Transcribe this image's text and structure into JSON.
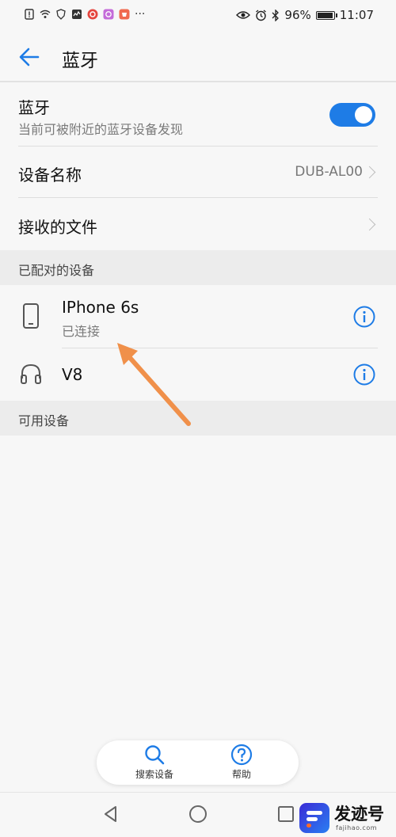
{
  "status_bar": {
    "battery_percent": "96%",
    "battery_level": 0.96,
    "time": "11:07",
    "more_indicator": "···"
  },
  "header": {
    "title": "蓝牙",
    "back_icon": "arrow-left-icon"
  },
  "bluetooth": {
    "title": "蓝牙",
    "subtitle": "当前可被附近的蓝牙设备发现",
    "enabled": true
  },
  "device_name": {
    "label": "设备名称",
    "value": "DUB-AL00"
  },
  "received_files": {
    "label": "接收的文件"
  },
  "paired_section": {
    "title": "已配对的设备",
    "devices": [
      {
        "name": "IPhone 6s",
        "status": "已连接",
        "icon": "phone-icon"
      },
      {
        "name": "V8",
        "status": "",
        "icon": "headset-icon"
      }
    ]
  },
  "available_section": {
    "title": "可用设备"
  },
  "bottom_bar": {
    "search_label": "搜索设备",
    "help_label": "帮助"
  },
  "watermark": {
    "text": "发迹号",
    "sub": "fajihao.com"
  },
  "colors": {
    "accent": "#1e7ce6",
    "annotation_arrow": "#f0904a",
    "background": "#f7f7f7"
  }
}
